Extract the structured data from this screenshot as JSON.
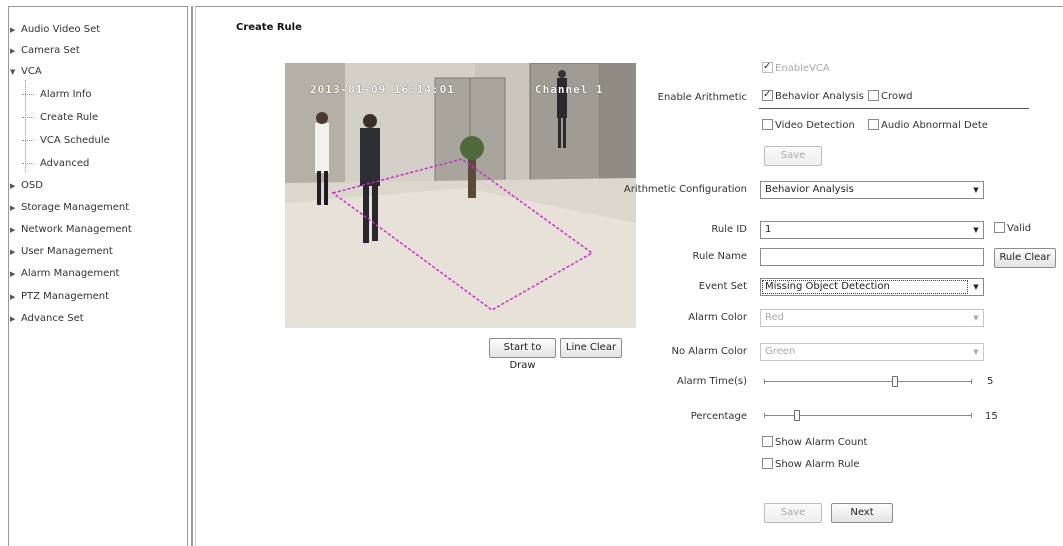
{
  "sidebar": {
    "items": [
      {
        "label": "Audio Video Set"
      },
      {
        "label": "Camera Set"
      },
      {
        "label": "VCA"
      },
      {
        "label": "OSD"
      },
      {
        "label": "Storage Management"
      },
      {
        "label": "Network Management"
      },
      {
        "label": "User Management"
      },
      {
        "label": "Alarm Management"
      },
      {
        "label": "PTZ Management"
      },
      {
        "label": "Advance Set"
      }
    ],
    "vca_children": [
      {
        "label": "Alarm Info"
      },
      {
        "label": "Create Rule"
      },
      {
        "label": "VCA Schedule"
      },
      {
        "label": "Advanced"
      }
    ]
  },
  "page": {
    "title": "Create Rule"
  },
  "video": {
    "osd_time": "2013-01-09 16:14:01",
    "osd_channel": "Channel 1",
    "draw_label": "Start to Draw",
    "clear_label": "Line Clear",
    "rule_line_color": "#d02ad0"
  },
  "form": {
    "enable_vca": {
      "label": "EnableVCA",
      "checked": true,
      "disabled": true
    },
    "enable_arithmetic_label": "Enable Arithmetic",
    "behavior_analysis": {
      "label": "Behavior Analysis",
      "checked": true
    },
    "crowd": {
      "label": "Crowd",
      "checked": false
    },
    "video_detection": {
      "label": "Video Detection",
      "checked": false
    },
    "audio_abnormal": {
      "label": "Audio Abnormal Dete",
      "checked": false
    },
    "save_top_label": "Save",
    "arith_config_label": "Arithmetic Configuration",
    "arith_config_value": "Behavior Analysis",
    "rule_id_label": "Rule ID",
    "rule_id_value": "1",
    "valid": {
      "label": "Valid",
      "checked": false
    },
    "rule_name_label": "Rule Name",
    "rule_name_value": "",
    "rule_clear_label": "Rule Clear",
    "event_set_label": "Event Set",
    "event_set_value": "Missing Object Detection",
    "alarm_color_label": "Alarm Color",
    "alarm_color_value": "Red",
    "no_alarm_color_label": "No Alarm Color",
    "no_alarm_color_value": "Green",
    "alarm_time_label": "Alarm Time(s)",
    "alarm_time_value": "5",
    "percentage_label": "Percentage",
    "percentage_value": "15",
    "show_alarm_count": {
      "label": "Show Alarm Count",
      "checked": false
    },
    "show_alarm_rule": {
      "label": "Show Alarm Rule",
      "checked": false
    },
    "save_bottom_label": "Save",
    "next_label": "Next"
  }
}
